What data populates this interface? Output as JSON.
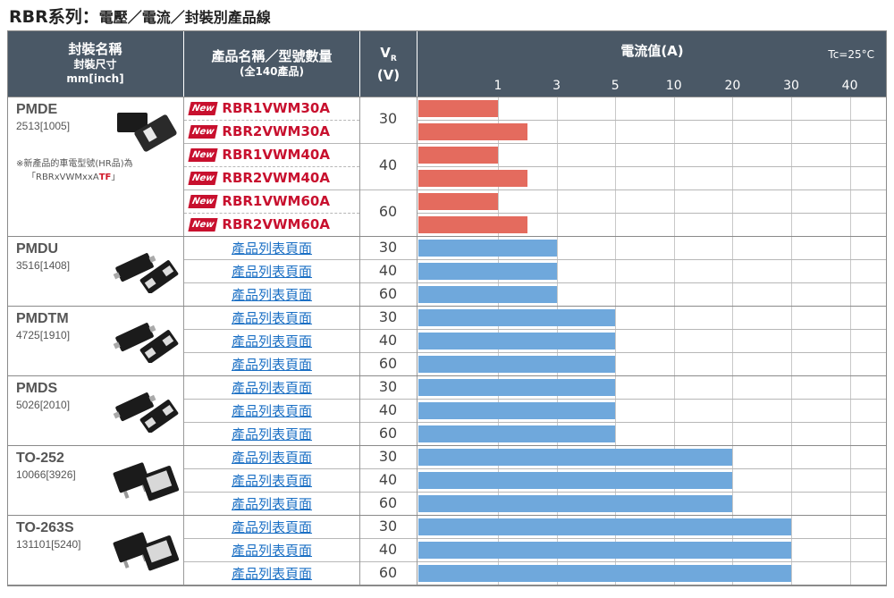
{
  "title": "RBR系列：",
  "subtitle": "電壓／電流／封裝別產品線",
  "header": {
    "col1": [
      "封裝名稱",
      "封裝尺寸",
      "mm[inch]"
    ],
    "col2": [
      "產品名稱／型號數量",
      "(全140產品)"
    ],
    "col3_main": "V",
    "col3_sub": "R",
    "col3_unit": "(V)",
    "col4": "電流值(A)",
    "tc": "Tc=25°C",
    "ticks": [
      "1",
      "3",
      "5",
      "10",
      "20",
      "30",
      "40"
    ]
  },
  "packages": [
    {
      "name": "PMDE",
      "size": "2513[1005]",
      "note1": "※新產品的車電型號(HR品)為",
      "note2_prefix": "「RBRxVWMxxA",
      "note2_red": "TF",
      "note2_suffix": "」"
    },
    {
      "name": "PMDU",
      "size": "3516[1408]"
    },
    {
      "name": "PMDTM",
      "size": "4725[1910]"
    },
    {
      "name": "PMDS",
      "size": "5026[2010]"
    },
    {
      "name": "TO-252",
      "size": "10066[3926]"
    },
    {
      "name": "TO-263S",
      "size": "131101[5240]"
    }
  ],
  "new_badge": "New",
  "new_products": [
    "RBR1VWM30A",
    "RBR2VWM30A",
    "RBR1VWM40A",
    "RBR2VWM40A",
    "RBR1VWM60A",
    "RBR2VWM60A"
  ],
  "link_text": "產品列表頁面",
  "vr_pmde": [
    "30",
    "40",
    "60"
  ],
  "vr_rows": [
    "30",
    "40",
    "60"
  ],
  "chart_data": {
    "type": "bar",
    "xlabel": "電流值(A)",
    "x_ticks": [
      "1",
      "3",
      "5",
      "10",
      "20",
      "30",
      "40"
    ],
    "rows": [
      {
        "product": "RBR1VWM30A",
        "vr": 30,
        "current": 1,
        "color": "#e46b5e"
      },
      {
        "product": "RBR2VWM30A",
        "vr": 30,
        "current": 2,
        "color": "#e46b5e"
      },
      {
        "product": "RBR1VWM40A",
        "vr": 40,
        "current": 1,
        "color": "#e46b5e"
      },
      {
        "product": "RBR2VWM40A",
        "vr": 40,
        "current": 2,
        "color": "#e46b5e"
      },
      {
        "product": "RBR1VWM60A",
        "vr": 60,
        "current": 1,
        "color": "#e46b5e"
      },
      {
        "product": "RBR2VWM60A",
        "vr": 60,
        "current": 2,
        "color": "#e46b5e"
      },
      {
        "package": "PMDU",
        "vr": 30,
        "current": 3,
        "color": "#6fa8dc"
      },
      {
        "package": "PMDU",
        "vr": 40,
        "current": 3,
        "color": "#6fa8dc"
      },
      {
        "package": "PMDU",
        "vr": 60,
        "current": 3,
        "color": "#6fa8dc"
      },
      {
        "package": "PMDTM",
        "vr": 30,
        "current": 5,
        "color": "#6fa8dc"
      },
      {
        "package": "PMDTM",
        "vr": 40,
        "current": 5,
        "color": "#6fa8dc"
      },
      {
        "package": "PMDTM",
        "vr": 60,
        "current": 5,
        "color": "#6fa8dc"
      },
      {
        "package": "PMDS",
        "vr": 30,
        "current": 5,
        "color": "#6fa8dc"
      },
      {
        "package": "PMDS",
        "vr": 40,
        "current": 5,
        "color": "#6fa8dc"
      },
      {
        "package": "PMDS",
        "vr": 60,
        "current": 5,
        "color": "#6fa8dc"
      },
      {
        "package": "TO-252",
        "vr": 30,
        "current": 20,
        "color": "#6fa8dc"
      },
      {
        "package": "TO-252",
        "vr": 40,
        "current": 20,
        "color": "#6fa8dc"
      },
      {
        "package": "TO-252",
        "vr": 60,
        "current": 20,
        "color": "#6fa8dc"
      },
      {
        "package": "TO-263S",
        "vr": 30,
        "current": 30,
        "color": "#6fa8dc"
      },
      {
        "package": "TO-263S",
        "vr": 40,
        "current": 30,
        "color": "#6fa8dc"
      },
      {
        "package": "TO-263S",
        "vr": 60,
        "current": 30,
        "color": "#6fa8dc"
      }
    ]
  }
}
